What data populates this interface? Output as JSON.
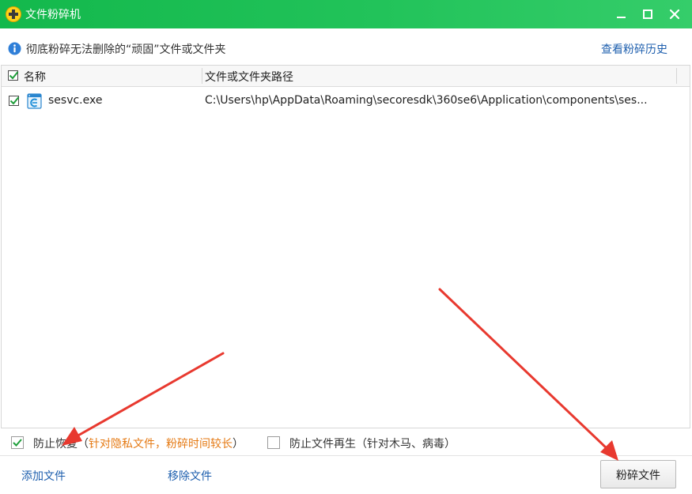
{
  "window": {
    "title": "文件粉碎机",
    "controls": [
      "minimize-icon",
      "maximize-icon",
      "close-icon"
    ]
  },
  "info": {
    "text": "彻底粉碎无法删除的“顽固”文件或文件夹",
    "history_link": "查看粉碎历史"
  },
  "list": {
    "columns": [
      "名称",
      "文件或文件夹路径"
    ],
    "rows": [
      {
        "name": "sesvc.exe",
        "path": "C:\\Users\\hp\\AppData\\Roaming\\secoresdk\\360se6\\Application\\components\\ses...",
        "checked": true
      }
    ]
  },
  "options": {
    "anti_recovery": {
      "label": "防止恢复",
      "open_paren": "（",
      "hint": "针对隐私文件，粉碎时间较长",
      "close_paren": "）",
      "checked": true
    },
    "anti_regen": {
      "label": "防止文件再生",
      "hint": "（针对木马、病毒）",
      "checked": false
    }
  },
  "bottom": {
    "add_file": "添加文件",
    "remove_file": "移除文件",
    "shred": "粉碎文件"
  },
  "colors": {
    "title_bar": "#22c35a",
    "link": "#1e5fae",
    "hint": "#e57a14",
    "arrow": "#e8392f"
  }
}
